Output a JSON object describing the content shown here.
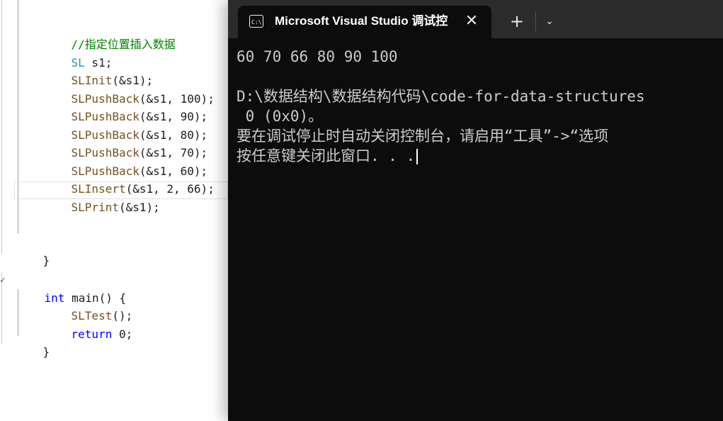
{
  "editor": {
    "lines": [
      {
        "comment": "//指定位置插入数据"
      },
      {
        "type": "SL",
        "rest": " s1;"
      },
      {
        "func": "SLInit",
        "rest": "(&s1);"
      },
      {
        "func": "SLPushBack",
        "rest": "(&s1, 100);"
      },
      {
        "func": "SLPushBack",
        "rest": "(&s1, 90);"
      },
      {
        "func": "SLPushBack",
        "rest": "(&s1, 80);"
      },
      {
        "func": "SLPushBack",
        "rest": "(&s1, 70);"
      },
      {
        "func": "SLPushBack",
        "rest": "(&s1, 60);"
      },
      {
        "func": "SLInsert",
        "rest": "(&s1, 2, 66);"
      },
      {
        "func": "SLPrint",
        "rest": "(&s1);"
      }
    ],
    "close_brace_1": "}",
    "main_keyword": "int",
    "main_rest": " main() {",
    "fold_mark": "✓",
    "call_func": "SLTest",
    "call_rest": "();",
    "return_keyword": "return",
    "return_rest": " 0;",
    "close_brace_2": "}"
  },
  "terminal": {
    "tab_title": "Microsoft Visual Studio 调试控",
    "tab_icon_text": "C:\\",
    "close_glyph": "✕",
    "new_tab_glyph": "+",
    "dropdown_glyph": "⌄",
    "output": {
      "line1": "60 70 66 80 90 100",
      "line2": "",
      "line3": "D:\\数据结构\\数据结构代码\\code-for-data-structures",
      "line4": " 0 (0x0)。",
      "line5": "要在调试停止时自动关闭控制台，请启用“工具”->“选项",
      "line6": "按任意键关闭此窗口. . ."
    }
  },
  "colors": {
    "terminal_bg": "#0c0c0c",
    "titlebar_bg": "#2b2b2b",
    "comment": "#008000",
    "type": "#2b91af",
    "keyword": "#0000ff",
    "function": "#74531f"
  }
}
